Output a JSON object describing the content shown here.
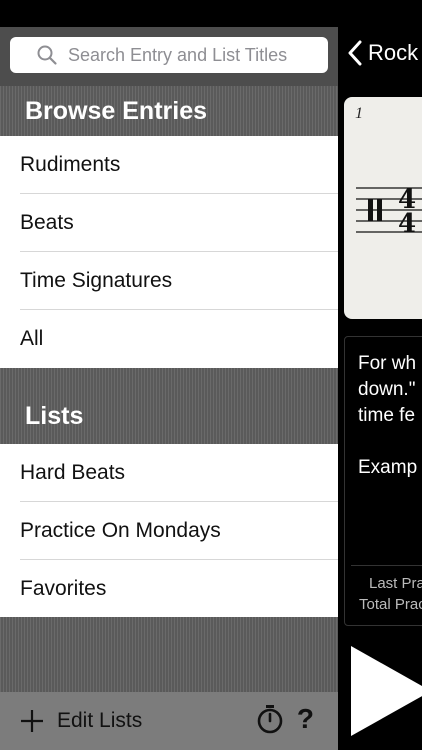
{
  "search": {
    "placeholder": "Search Entry and List Titles"
  },
  "browse": {
    "header": "Browse Entries",
    "items": [
      {
        "label": "Rudiments"
      },
      {
        "label": "Beats"
      },
      {
        "label": "Time Signatures"
      },
      {
        "label": "All"
      }
    ]
  },
  "lists": {
    "header": "Lists",
    "items": [
      {
        "label": "Hard Beats"
      },
      {
        "label": "Practice On Mondays"
      },
      {
        "label": "Favorites"
      }
    ]
  },
  "toolbar": {
    "edit_lists_label": "Edit Lists",
    "help_label": "?",
    "icons": [
      "plus-icon",
      "stopwatch-icon",
      "help-icon"
    ]
  },
  "detail": {
    "back_label": "Rock",
    "measure_number": "1",
    "time_signature": {
      "top": "4",
      "bottom": "4"
    },
    "description_lines": [
      "For wh",
      "down.\"",
      "time fe",
      "Examp"
    ],
    "stats": {
      "last_practiced_label": "Last Pra",
      "total_practiced_label": "Total Prac"
    }
  },
  "colors": {
    "sidebar_bg": "#4a4a4a",
    "list_bg": "#ffffff",
    "toolbar_bg": "#7c7c7c",
    "main_bg": "#000000",
    "header_text": "#ffffff"
  }
}
